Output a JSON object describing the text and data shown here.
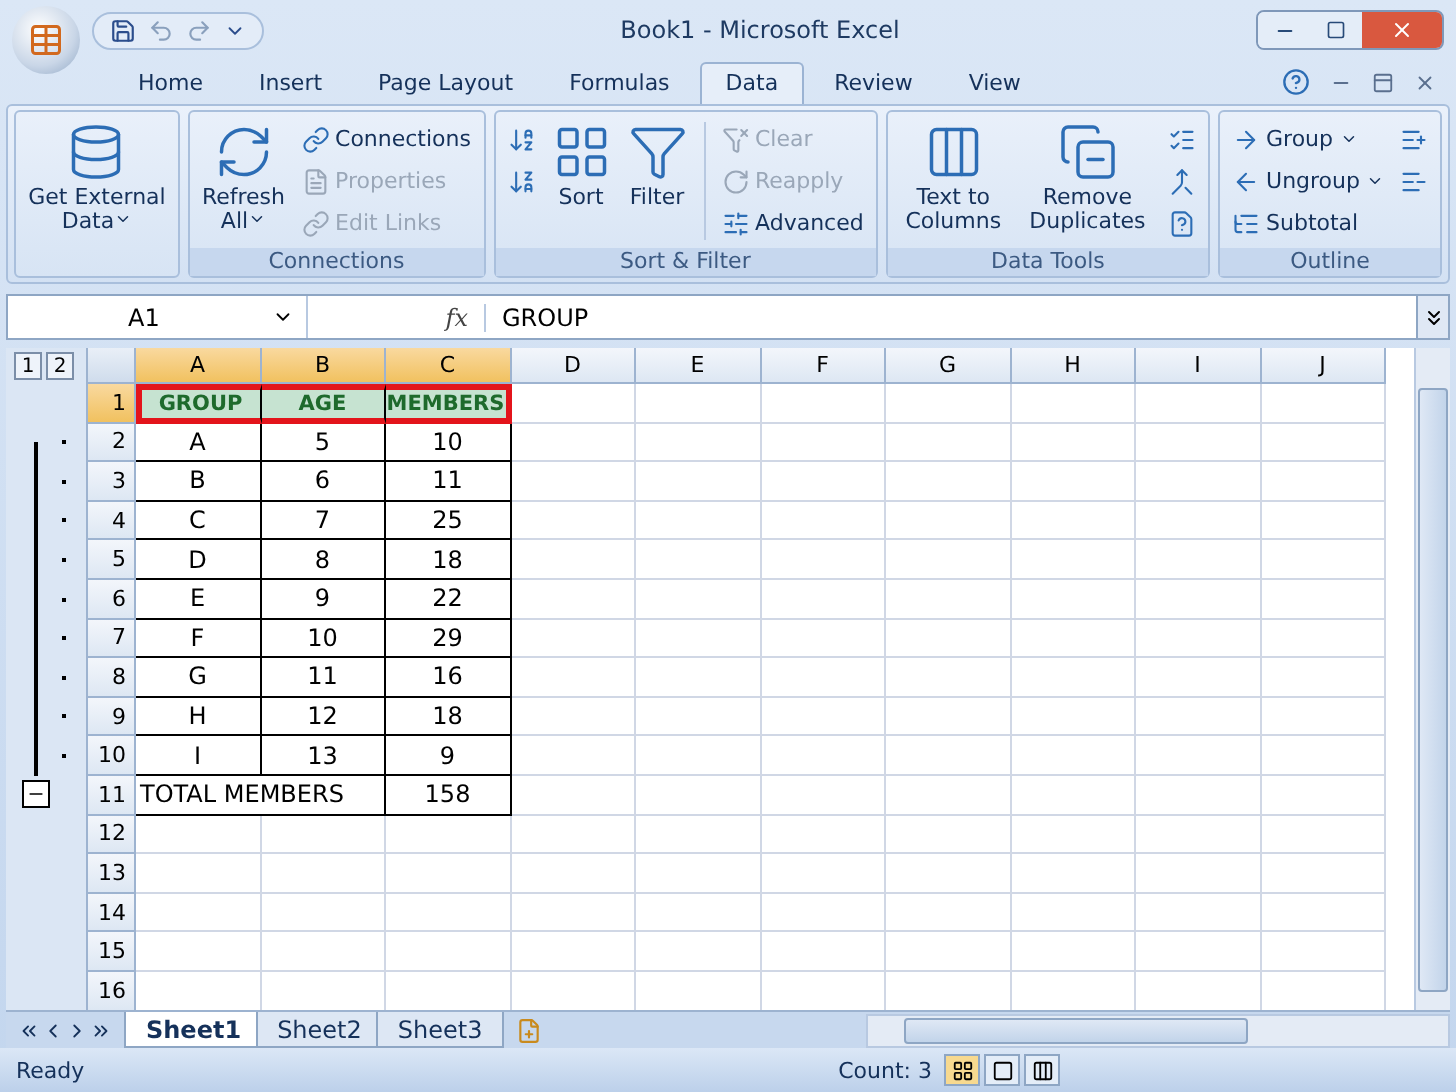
{
  "window": {
    "title": "Book1 - Microsoft Excel"
  },
  "ribbon": {
    "tabs": [
      {
        "label": "Home",
        "selected": false
      },
      {
        "label": "Insert",
        "selected": false
      },
      {
        "label": "Page Layout",
        "selected": false
      },
      {
        "label": "Formulas",
        "selected": false
      },
      {
        "label": "Data",
        "selected": true
      },
      {
        "label": "Review",
        "selected": false
      },
      {
        "label": "View",
        "selected": false
      }
    ],
    "groups": [
      {
        "items": [
          {
            "kind": "large",
            "label": "Get External Data",
            "disabled": false,
            "dropdown": true
          }
        ]
      },
      {
        "label": "Connections",
        "items": [
          {
            "kind": "large",
            "label": "Refresh All",
            "disabled": false,
            "dropdown": true
          },
          {
            "kind": "small",
            "label": "Connections",
            "disabled": false
          },
          {
            "kind": "small",
            "label": "Properties",
            "disabled": true
          },
          {
            "kind": "small",
            "label": "Edit Links",
            "disabled": true
          }
        ]
      },
      {
        "label": "Sort & Filter",
        "items": [
          {
            "kind": "icon",
            "disabled": false
          },
          {
            "kind": "icon",
            "disabled": false
          },
          {
            "kind": "large",
            "label": "Sort",
            "disabled": false,
            "dropdown": false
          },
          {
            "kind": "large",
            "label": "Filter",
            "disabled": false,
            "dropdown": false
          },
          {
            "kind": "small",
            "label": "Clear",
            "disabled": true
          },
          {
            "kind": "small",
            "label": "Reapply",
            "disabled": true
          },
          {
            "kind": "small",
            "label": "Advanced",
            "disabled": false
          }
        ]
      },
      {
        "label": "Data Tools",
        "items": [
          {
            "kind": "large",
            "label": "Text to Columns",
            "disabled": false,
            "dropdown": false
          },
          {
            "kind": "large",
            "label": "Remove Duplicates",
            "disabled": false,
            "dropdown": false
          },
          {
            "kind": "icon",
            "disabled": false
          },
          {
            "kind": "icon",
            "disabled": false
          },
          {
            "kind": "icon",
            "disabled": false
          }
        ]
      },
      {
        "label": "Outline",
        "items": [
          {
            "kind": "small",
            "label": "Group",
            "disabled": false,
            "dropdown": true
          },
          {
            "kind": "small",
            "label": "Ungroup",
            "disabled": false,
            "dropdown": true
          },
          {
            "kind": "small",
            "label": "Subtotal",
            "disabled": false
          },
          {
            "kind": "icon",
            "disabled": false
          },
          {
            "kind": "icon",
            "disabled": false
          }
        ]
      }
    ]
  },
  "formula_bar": {
    "name_box": "A1",
    "function_label": "fx",
    "value": "GROUP"
  },
  "outline": {
    "levels": [
      "1",
      "2"
    ],
    "marks": [
      {
        "kind": "blank"
      },
      {
        "kind": "dot"
      },
      {
        "kind": "dot"
      },
      {
        "kind": "dot"
      },
      {
        "kind": "dot"
      },
      {
        "kind": "dot"
      },
      {
        "kind": "dot"
      },
      {
        "kind": "dot"
      },
      {
        "kind": "dot"
      },
      {
        "kind": "dot"
      },
      {
        "kind": "collapse"
      },
      {
        "kind": "blank"
      },
      {
        "kind": "blank"
      },
      {
        "kind": "blank"
      },
      {
        "kind": "blank"
      },
      {
        "kind": "blank"
      }
    ]
  },
  "sheet": {
    "columns": [
      {
        "label": "A",
        "selected": true
      },
      {
        "label": "B",
        "selected": true
      },
      {
        "label": "C",
        "selected": true
      },
      {
        "label": "D",
        "selected": false
      },
      {
        "label": "E",
        "selected": false
      },
      {
        "label": "F",
        "selected": false
      },
      {
        "label": "G",
        "selected": false
      },
      {
        "label": "H",
        "selected": false
      },
      {
        "label": "I",
        "selected": false
      },
      {
        "label": "J",
        "selected": false
      }
    ],
    "rows": [
      {
        "header": "1",
        "selected": true,
        "kind": "heading",
        "cells": [
          {
            "text": "GROUP"
          },
          {
            "text": "AGE"
          },
          {
            "text": "MEMBERS"
          }
        ]
      },
      {
        "header": "2",
        "selected": false,
        "kind": "data",
        "cells": [
          {
            "text": "A"
          },
          {
            "text": "5"
          },
          {
            "text": "10"
          }
        ]
      },
      {
        "header": "3",
        "selected": false,
        "kind": "data",
        "cells": [
          {
            "text": "B"
          },
          {
            "text": "6"
          },
          {
            "text": "11"
          }
        ]
      },
      {
        "header": "4",
        "selected": false,
        "kind": "data",
        "cells": [
          {
            "text": "C"
          },
          {
            "text": "7"
          },
          {
            "text": "25"
          }
        ]
      },
      {
        "header": "5",
        "selected": false,
        "kind": "data",
        "cells": [
          {
            "text": "D"
          },
          {
            "text": "8"
          },
          {
            "text": "18"
          }
        ]
      },
      {
        "header": "6",
        "selected": false,
        "kind": "data",
        "cells": [
          {
            "text": "E"
          },
          {
            "text": "9"
          },
          {
            "text": "22"
          }
        ]
      },
      {
        "header": "7",
        "selected": false,
        "kind": "data",
        "cells": [
          {
            "text": "F"
          },
          {
            "text": "10"
          },
          {
            "text": "29"
          }
        ]
      },
      {
        "header": "8",
        "selected": false,
        "kind": "data",
        "cells": [
          {
            "text": "G"
          },
          {
            "text": "11"
          },
          {
            "text": "16"
          }
        ]
      },
      {
        "header": "9",
        "selected": false,
        "kind": "data",
        "cells": [
          {
            "text": "H"
          },
          {
            "text": "12"
          },
          {
            "text": "18"
          }
        ]
      },
      {
        "header": "10",
        "selected": false,
        "kind": "data",
        "cells": [
          {
            "text": "I"
          },
          {
            "text": "13"
          },
          {
            "text": "9"
          }
        ]
      },
      {
        "header": "11",
        "selected": false,
        "kind": "total",
        "cells": [
          {
            "text": "TOTAL MEMBERS"
          },
          {
            "text": ""
          },
          {
            "text": "158"
          }
        ]
      },
      {
        "header": "12",
        "selected": false
      },
      {
        "header": "13",
        "selected": false
      },
      {
        "header": "14",
        "selected": false
      },
      {
        "header": "15",
        "selected": false
      },
      {
        "header": "16",
        "selected": false
      }
    ]
  },
  "sheet_tabs": [
    {
      "label": "Sheet1",
      "selected": true
    },
    {
      "label": "Sheet2",
      "selected": false
    },
    {
      "label": "Sheet3",
      "selected": false
    }
  ],
  "status_bar": {
    "mode": "Ready",
    "count": "Count: 3"
  }
}
